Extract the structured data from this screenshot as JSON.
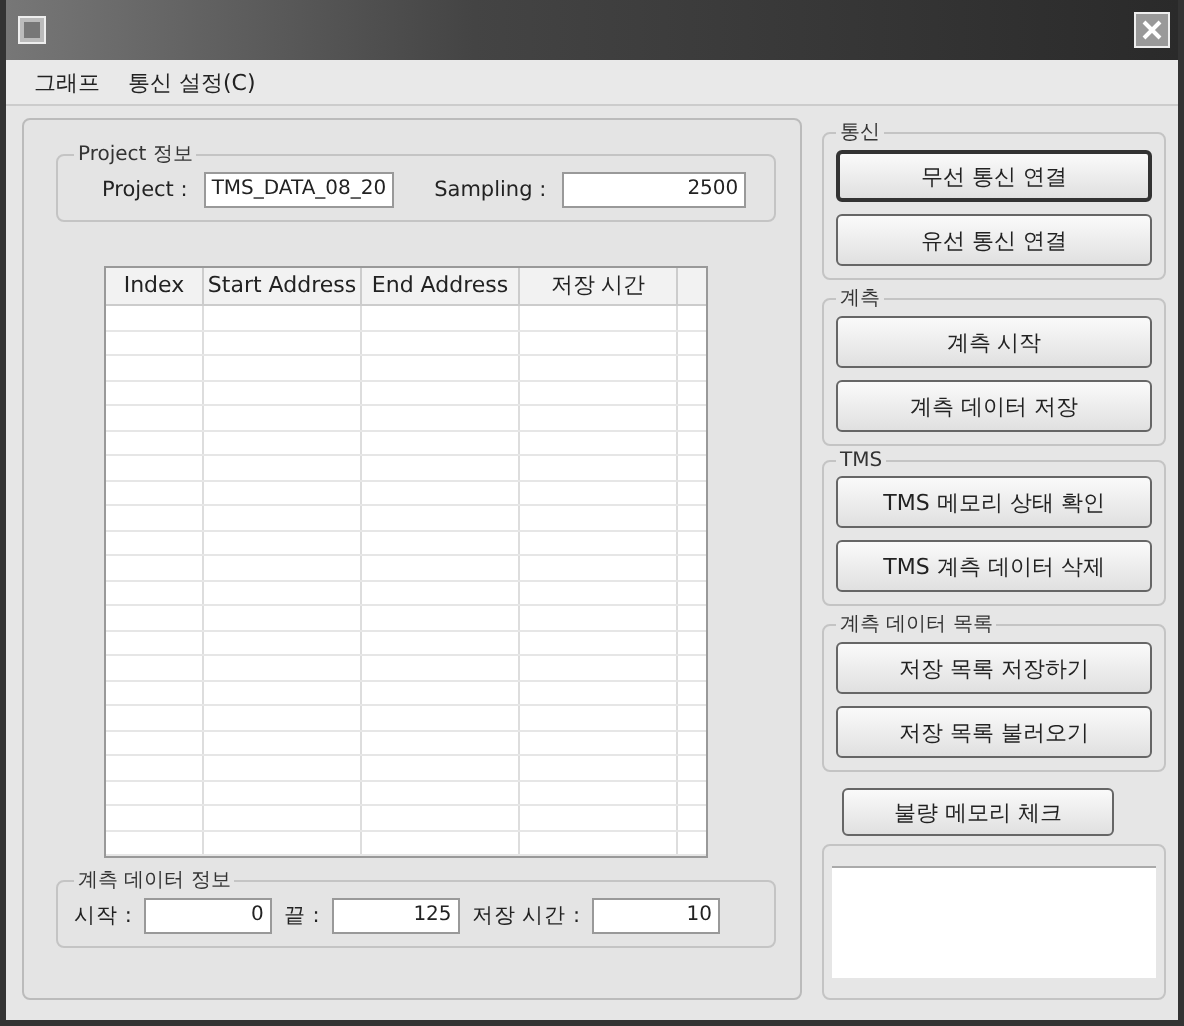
{
  "menu": [
    {
      "label": "그래프"
    },
    {
      "label": "통신 설정(C)"
    }
  ],
  "project_group": {
    "title": "Project 정보",
    "fields": [
      {
        "label": "Project :",
        "value": "TMS_DATA_08_20"
      },
      {
        "label": "Sampling :",
        "value": "2500"
      }
    ]
  },
  "table": {
    "columns": [
      "Index",
      "Start Address",
      "End Address",
      "저장 시간"
    ]
  },
  "measure_info": {
    "title": "계측 데이터 정보",
    "fields": [
      {
        "label": "시작 :",
        "value": "0"
      },
      {
        "label": "끝 :",
        "value": "125"
      },
      {
        "label": "저장 시간 :",
        "value": "10"
      }
    ]
  },
  "right_groups": [
    {
      "title": "통신",
      "buttons": [
        {
          "label": "무선 통신 연결",
          "focused": true
        },
        {
          "label": "유선 통신 연결",
          "focused": false
        }
      ]
    },
    {
      "title": "계측",
      "buttons": [
        {
          "label": "계측 시작",
          "focused": false
        },
        {
          "label": "계측 데이터 저장",
          "focused": false
        }
      ]
    },
    {
      "title": "TMS",
      "buttons": [
        {
          "label": "TMS 메모리 상태 확인",
          "focused": false
        },
        {
          "label": "TMS 계측 데이터 삭제",
          "focused": false
        }
      ]
    },
    {
      "title": "계측 데이터 목록",
      "buttons": [
        {
          "label": "저장 목록 저장하기",
          "focused": false
        },
        {
          "label": "저장 목록 불러오기",
          "focused": false
        }
      ]
    }
  ],
  "check_button": {
    "label": "불량 메모리 체크",
    "focused": false
  }
}
